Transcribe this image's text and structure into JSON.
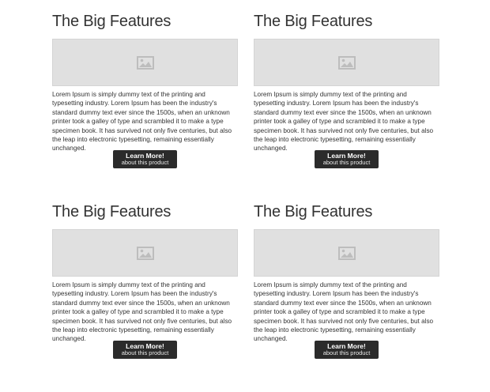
{
  "features": [
    {
      "title": "The Big Features",
      "image_icon": "image-placeholder-icon",
      "description": "Lorem Ipsum is simply dummy text of the printing and typesetting industry. Lorem Ipsum has been the industry's standard dummy text ever since the 1500s, when an unknown printer took a galley of type and scrambled it to make a type specimen book. It has survived not only five centuries, but also the leap into electronic typesetting, remaining essentially unchanged.",
      "button_label": "Learn More!",
      "button_sublabel": "about this product"
    },
    {
      "title": "The Big Features",
      "image_icon": "image-placeholder-icon",
      "description": "Lorem Ipsum is simply dummy text of the printing and typesetting industry. Lorem Ipsum has been the industry's standard dummy text ever since the 1500s, when an unknown printer took a galley of type and scrambled it to make a type specimen book. It has survived not only five centuries, but also the leap into electronic typesetting, remaining essentially unchanged.",
      "button_label": "Learn More!",
      "button_sublabel": "about this product"
    },
    {
      "title": "The Big Features",
      "image_icon": "image-placeholder-icon",
      "description": "Lorem Ipsum is simply dummy text of the printing and typesetting industry. Lorem Ipsum has been the industry's standard dummy text ever since the 1500s, when an unknown printer took a galley of type and scrambled it to make a type specimen book. It has survived not only five centuries, but also the leap into electronic typesetting, remaining essentially unchanged.",
      "button_label": "Learn More!",
      "button_sublabel": "about this product"
    },
    {
      "title": "The Big Features",
      "image_icon": "image-placeholder-icon",
      "description": "Lorem Ipsum is simply dummy text of the printing and typesetting industry. Lorem Ipsum has been the industry's standard dummy text ever since the 1500s, when an unknown printer took a galley of type and scrambled it to make a type specimen book. It has survived not only five centuries, but also the leap into electronic typesetting, remaining essentially unchanged.",
      "button_label": "Learn More!",
      "button_sublabel": "about this product"
    }
  ],
  "colors": {
    "text": "#333333",
    "placeholder_bg": "#e0e0e0",
    "placeholder_icon": "#bdbdbd",
    "button_bg": "#2b2b2b",
    "button_text": "#ffffff"
  }
}
